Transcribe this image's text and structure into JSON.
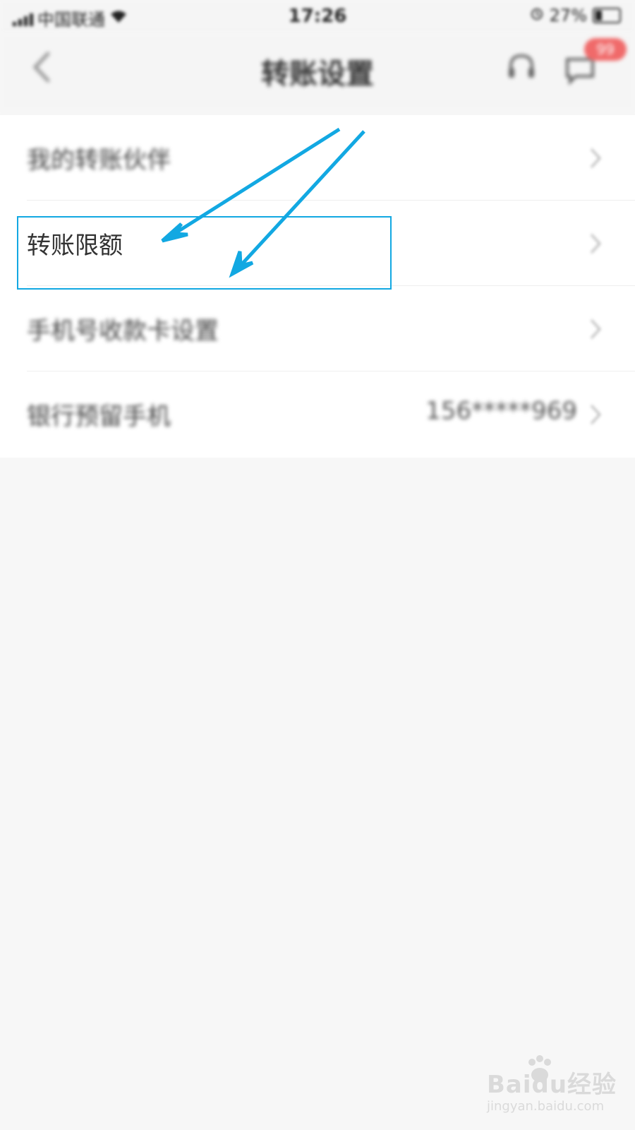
{
  "status_bar": {
    "carrier": "中国联通",
    "time": "17:26",
    "battery": "27%",
    "battery_level": 0.27
  },
  "header": {
    "title": "转账设置",
    "badge_count": "99"
  },
  "settings": {
    "items": [
      {
        "label": "我的转账伙伴",
        "value": ""
      },
      {
        "label": "转账限额",
        "value": ""
      },
      {
        "label": "手机号收款卡设置",
        "value": ""
      },
      {
        "label": "银行预留手机",
        "value": "156*****969"
      }
    ]
  },
  "watermark": {
    "brand": "Baidu经验",
    "url": "jingyan.baidu.com"
  },
  "colors": {
    "annotation": "#12a8e2",
    "badge": "#f06a6a",
    "background": "#f7f7f7"
  }
}
